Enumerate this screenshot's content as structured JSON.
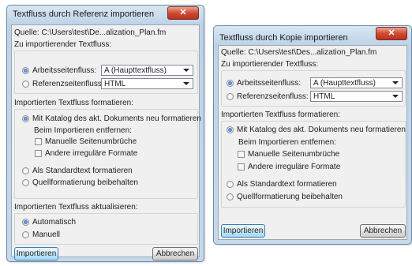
{
  "left_dialog": {
    "title": "Textfluss durch Referenz importieren",
    "close_glyph": "✕",
    "source_text": "Quelle: C:\\Users\\test\\De...alization_Plan.fm",
    "import_flow_label": "Zu importierender Textfluss:",
    "main_flow_label": "Arbeitsseitenfluss:",
    "main_flow_value": "A (Haupttextfluss)",
    "ref_flow_label": "Referenzseitenfluss:",
    "ref_flow_value": "HTML",
    "format_label": "Importierten Textfluss formatieren:",
    "catalog_option": "Mit Katalog des akt. Dokuments neu formatieren",
    "remove_label": "Beim Importieren entfernen:",
    "manual_breaks": "Manuelle Seitenumbrüche",
    "other_formats": "Andere irreguläre Formate",
    "standard_option": "Als Standardtext formatieren",
    "keep_option": "Quellformatierung beibehalten",
    "update_label": "Importierten Textfluss aktualisieren:",
    "auto_option": "Automatisch",
    "manual_option": "Manuell",
    "import_button": "Importieren",
    "cancel_button": "Abbrechen"
  },
  "right_dialog": {
    "title": "Textfluss durch Kopie importieren",
    "close_glyph": "✕",
    "source_text": "Quelle: C:\\Users\\test\\Des...alization_Plan.fm",
    "import_flow_label": "Zu importierender Textfluss:",
    "main_flow_label": "Arbeitsseitenfluss:",
    "main_flow_value": "A (Haupttextfluss)",
    "ref_flow_label": "Referenzseitenfluss:",
    "ref_flow_value": "HTML",
    "format_label": "Importierten Textfluss formatieren:",
    "catalog_option": "Mit Katalog des akt. Dokuments neu formatieren",
    "remove_label": "Beim Importieren entfernen:",
    "manual_breaks": "Manuelle Seitenumbrüche",
    "other_formats": "Andere irreguläre Formate",
    "standard_option": "Als Standardtext formatieren",
    "keep_option": "Quellformatierung beibehalten",
    "import_button": "Importieren",
    "cancel_button": "Abbrechen"
  },
  "colors": {
    "title_bar": "#c5d8ec",
    "close_button": "#cf4b33",
    "dialog_body": "#f0f0f0",
    "selected_radio": "#1b57b3"
  }
}
